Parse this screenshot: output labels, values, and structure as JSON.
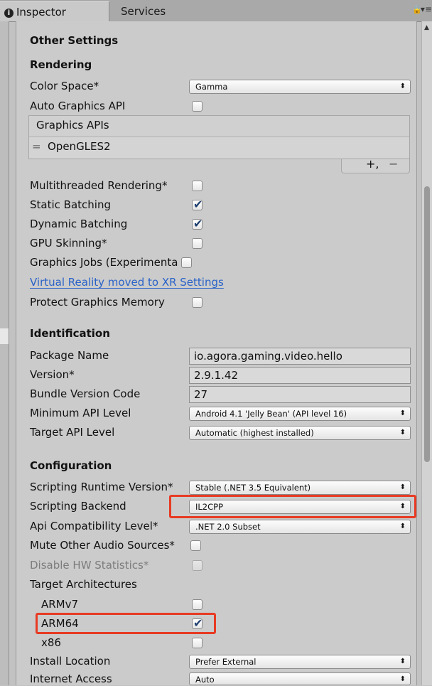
{
  "tabs": [
    {
      "label": "Inspector",
      "icon": "info-icon"
    },
    {
      "label": "Services"
    }
  ],
  "header": {
    "info_glyph": "i",
    "lock_glyph": "🔒",
    "menu_glyph": "▾≡"
  },
  "sections": {
    "other_settings": "Other Settings",
    "rendering": "Rendering",
    "identification": "Identification",
    "configuration": "Configuration"
  },
  "rendering": {
    "color_space_label": "Color Space*",
    "color_space_value": "Gamma",
    "auto_graphics_label": "Auto Graphics API",
    "graphics_apis_header": "Graphics APIs",
    "graphics_api_item": "OpenGLES2",
    "drag_handle_glyph": "=",
    "add_glyph": "+,",
    "remove_glyph": "−",
    "multithreaded_label": "Multithreaded Rendering*",
    "static_batching_label": "Static Batching",
    "dynamic_batching_label": "Dynamic Batching",
    "gpu_skinning_label": "GPU Skinning*",
    "graphics_jobs_label": "Graphics Jobs (Experimenta",
    "vr_link": "Virtual Reality moved to XR Settings",
    "protect_memory_label": "Protect Graphics Memory",
    "checks": {
      "auto_graphics": false,
      "multithreaded": false,
      "static_batching": true,
      "dynamic_batching": true,
      "gpu_skinning": false,
      "graphics_jobs": false,
      "protect_memory": false
    }
  },
  "identification": {
    "package_name_label": "Package Name",
    "package_name_value": "io.agora.gaming.video.hello",
    "version_label": "Version*",
    "version_value": "2.9.1.42",
    "bundle_code_label": "Bundle Version Code",
    "bundle_code_value": "27",
    "min_api_label": "Minimum API Level",
    "min_api_value": "Android 4.1 'Jelly Bean' (API level 16)",
    "target_api_label": "Target API Level",
    "target_api_value": "Automatic (highest installed)"
  },
  "configuration": {
    "runtime_label": "Scripting Runtime Version*",
    "runtime_value": "Stable (.NET 3.5 Equivalent)",
    "backend_label": "Scripting Backend",
    "backend_value": "IL2CPP",
    "api_compat_label": "Api Compatibility Level*",
    "api_compat_value": ".NET 2.0 Subset",
    "mute_audio_label": "Mute Other Audio Sources*",
    "disable_hw_label": "Disable HW Statistics*",
    "target_arch_label": "Target Architectures",
    "armv7_label": "ARMv7",
    "arm64_label": "ARM64",
    "x86_label": "x86",
    "install_location_label": "Install Location",
    "install_location_value": "Prefer External",
    "internet_access_label": "Internet Access",
    "internet_access_value": "Auto",
    "checks": {
      "mute_audio": false,
      "disable_hw": false,
      "armv7": false,
      "arm64": true,
      "x86": false
    }
  },
  "dropdown_arrow_glyph": "⬍",
  "colors": {
    "highlight": "#e83a23",
    "link": "#2a63c8",
    "check": "#1f3f6f"
  }
}
